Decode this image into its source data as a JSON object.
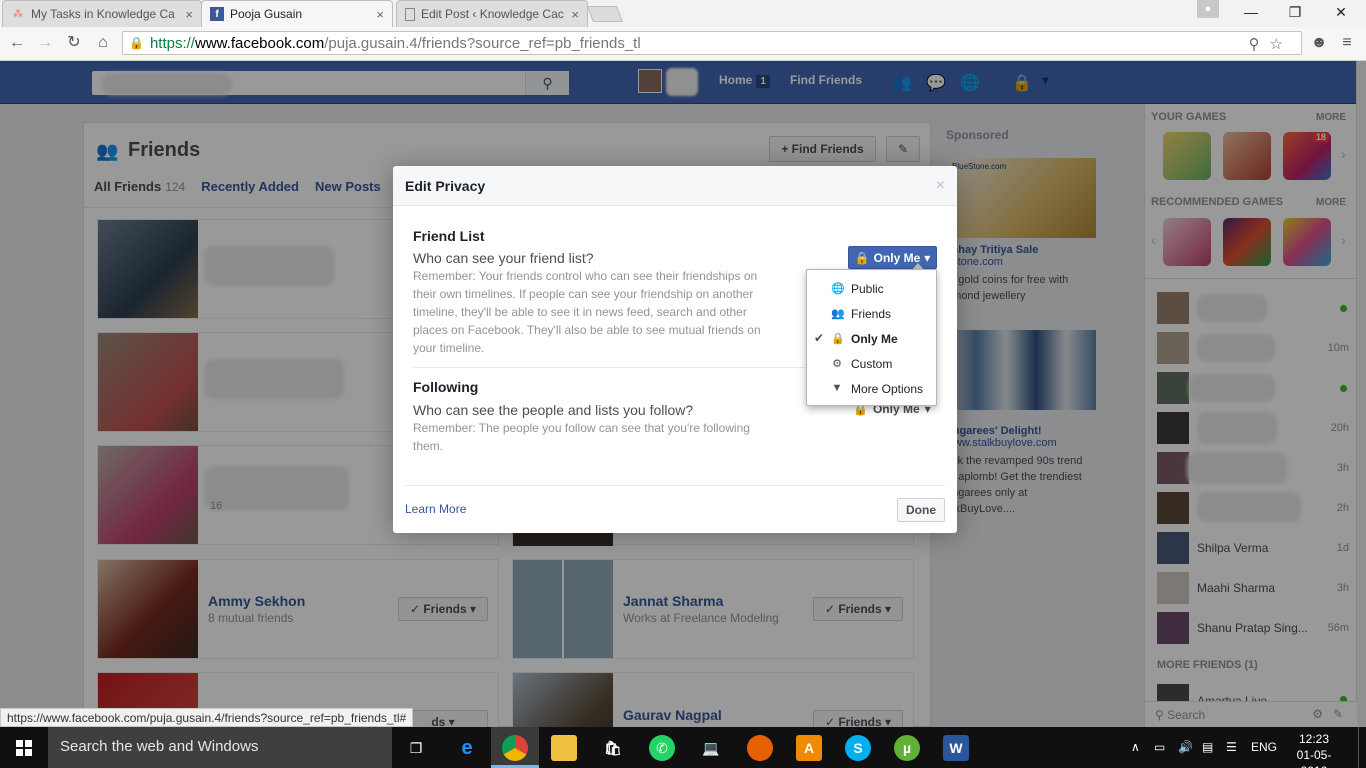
{
  "browser": {
    "tabs": [
      {
        "title": "My Tasks in Knowledge Ca",
        "close": "×"
      },
      {
        "title": "Pooja Gusain",
        "close": "×"
      },
      {
        "title": "Edit Post ‹ Knowledge Cac",
        "close": "×"
      }
    ],
    "url_scheme": "https://",
    "url_host": "www.facebook.com",
    "url_path": "/puja.gusain.4/friends?source_ref=pb_friends_tl"
  },
  "fb_header": {
    "home_label": "Home",
    "home_count": "1",
    "find_friends_label": "Find Friends"
  },
  "friends": {
    "title": "Friends",
    "find_friends_btn": "Find Friends",
    "tabs": {
      "all": "All Friends",
      "all_count": "124",
      "recent": "Recently Added",
      "new_posts": "New Posts"
    },
    "cards": [
      {
        "name": "Ammy Sekhon",
        "sub": "8 mutual friends",
        "button": "Friends"
      },
      {
        "name": "Jannat Sharma",
        "sub": "Works at Freelance Modeling",
        "button": "Friends"
      },
      {
        "name": "Gaurav Nagpal",
        "sub": "",
        "button": "Friends"
      }
    ],
    "partial_row_btn_text": "ds",
    "partial_row_count": "16"
  },
  "sponsored": {
    "heading": "Sponsored",
    "ad1": {
      "brand": "BlueStone.com",
      "title": "kshay Tritiya Sale",
      "url": "estone.com",
      "text": "et gold coins for free with\namond jewellery"
    },
    "ad2": {
      "title": "ungarees' Delight!",
      "url": "www.stalkbuylove.com",
      "text": "ock the revamped 90s trend\nth aplomb! Get the trendiest\nungarees only at\nalkBuyLove...."
    }
  },
  "chat": {
    "your_games": "YOUR GAMES",
    "more": "MORE",
    "recommended_games": "RECOMMENDED GAMES",
    "game_badge": "18",
    "rows": [
      {
        "name": "",
        "time": "",
        "online": true
      },
      {
        "name": "",
        "time": "10m",
        "online": false
      },
      {
        "name": "",
        "time": "",
        "online": true
      },
      {
        "name": "",
        "time": "20h",
        "online": false
      },
      {
        "name": "",
        "time": "3h",
        "online": false
      },
      {
        "name": "",
        "time": "2h",
        "online": false
      },
      {
        "name": "Shilpa Verma",
        "time": "1d",
        "online": false
      },
      {
        "name": "Maahi Sharma",
        "time": "3h",
        "online": false
      },
      {
        "name": "Shanu Pratap Sing...",
        "time": "56m",
        "online": false
      }
    ],
    "more_friends": "MORE FRIENDS (1)",
    "partial_friend": "Amartya Live",
    "search_placeholder": "Search"
  },
  "modal": {
    "title": "Edit Privacy",
    "close": "×",
    "section1": {
      "heading": "Friend List",
      "question": "Who can see your friend list?",
      "reminder": "Remember: Your friends control who can see their friendships on their own timelines. If people can see your friendship on another timeline, they'll be able to see it in news feed, search and other places on Facebook. They'll also be able to see mutual friends on your timeline.",
      "selected": "Only Me"
    },
    "section2": {
      "heading": "Following",
      "question": "Who can see the people and lists you follow?",
      "reminder": "Remember: The people you follow can see that you're following them.",
      "selected": "Only Me"
    },
    "learn_more": "Learn More",
    "done": "Done"
  },
  "privacy_menu": {
    "items": [
      {
        "label": "Public",
        "icon": "globe-icon"
      },
      {
        "label": "Friends",
        "icon": "friends-icon"
      },
      {
        "label": "Only Me",
        "icon": "lock-icon",
        "selected": true
      },
      {
        "label": "Custom",
        "icon": "gear-icon"
      },
      {
        "label": "More Options",
        "icon": "caret-down-icon"
      }
    ]
  },
  "status_url": "https://www.facebook.com/puja.gusain.4/friends?source_ref=pb_friends_tl#",
  "taskbar": {
    "search_text": "Search the web and Windows",
    "lang": "ENG",
    "time": "12:23",
    "date": "01-05-2016"
  },
  "colors": {
    "fb_blue": "#4267b2",
    "link": "#365899",
    "online": "#42b72a"
  }
}
